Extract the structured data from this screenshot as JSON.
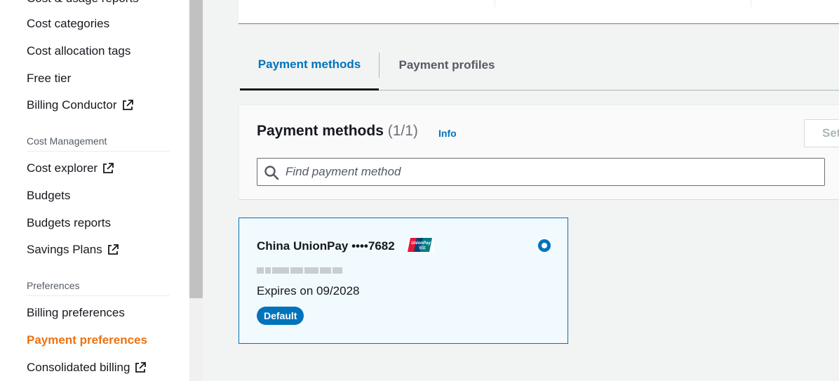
{
  "sidebar": {
    "top_cut_label": "Cost & usage reports",
    "items_group1": [
      {
        "label": "Cost categories",
        "external": false
      },
      {
        "label": "Cost allocation tags",
        "external": false
      },
      {
        "label": "Free tier",
        "external": false
      },
      {
        "label": "Billing Conductor",
        "external": true
      }
    ],
    "section_cost_management": "Cost Management",
    "items_group2": [
      {
        "label": "Cost explorer",
        "external": true
      },
      {
        "label": "Budgets",
        "external": false
      },
      {
        "label": "Budgets reports",
        "external": false
      },
      {
        "label": "Savings Plans",
        "external": true
      }
    ],
    "section_preferences": "Preferences",
    "items_group3": [
      {
        "label": "Billing preferences",
        "external": false
      },
      {
        "label": "Payment preferences",
        "external": false,
        "active": true
      },
      {
        "label": "Consolidated billing",
        "external": true
      }
    ]
  },
  "tabs": [
    {
      "label": "Payment methods",
      "active": true
    },
    {
      "label": "Payment profiles",
      "active": false
    }
  ],
  "payment_methods": {
    "title": "Payment methods",
    "count": "(1/1)",
    "info_label": "Info",
    "set_button_label": "Set",
    "search_placeholder": "Find payment method"
  },
  "card": {
    "name": "China UnionPay ••••7682",
    "logo_text": "UnionPay 银联",
    "logo_icon": "unionpay-logo",
    "expires": "Expires on 09/2028",
    "badge": "Default",
    "selected": true
  },
  "colors": {
    "accent": "#0073bb",
    "active_nav": "#ec7211",
    "selected_card_bg": "#f1faff"
  }
}
